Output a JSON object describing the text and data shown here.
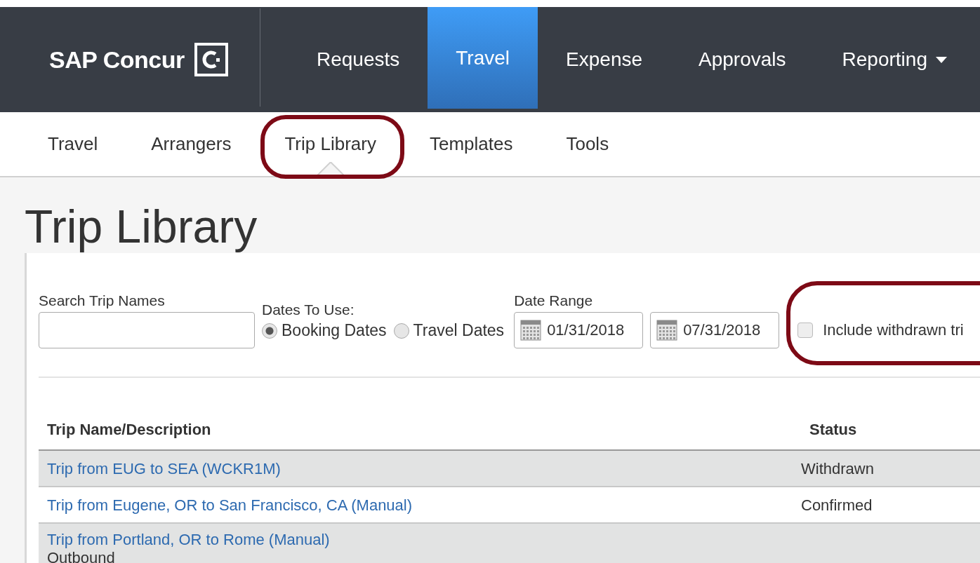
{
  "brand": {
    "name": "SAP Concur"
  },
  "nav": [
    {
      "label": "Requests",
      "selected": false,
      "dropdown": false
    },
    {
      "label": "Travel",
      "selected": true,
      "dropdown": false
    },
    {
      "label": "Expense",
      "selected": false,
      "dropdown": false
    },
    {
      "label": "Approvals",
      "selected": false,
      "dropdown": false
    },
    {
      "label": "Reporting",
      "selected": false,
      "dropdown": true
    }
  ],
  "subnav": [
    {
      "label": "Travel",
      "selected": false
    },
    {
      "label": "Arrangers",
      "selected": false
    },
    {
      "label": "Trip Library",
      "selected": true
    },
    {
      "label": "Templates",
      "selected": false
    },
    {
      "label": "Tools",
      "selected": false
    }
  ],
  "page_title": "Trip Library",
  "filters": {
    "search": {
      "label": "Search Trip Names"
    },
    "dates_to_use": {
      "label": "Dates To Use:",
      "options": [
        {
          "label": "Booking Dates",
          "selected": true
        },
        {
          "label": "Travel Dates",
          "selected": false
        }
      ]
    },
    "date_range": {
      "label": "Date Range",
      "start": "01/31/2018",
      "end": "07/31/2018"
    },
    "include_withdrawn": {
      "label": "Include withdrawn tri",
      "checked": false
    }
  },
  "table": {
    "columns": [
      "Trip Name/Description",
      "Status"
    ],
    "rows": [
      {
        "name": "Trip from EUG to SEA (WCKR1M)",
        "status": "Withdrawn"
      },
      {
        "name": "Trip from Eugene, OR to San Francisco, CA (Manual)",
        "status": "Confirmed"
      },
      {
        "name": "Trip from Portland, OR to Rome (Manual)",
        "detail": "Outbound"
      }
    ]
  }
}
